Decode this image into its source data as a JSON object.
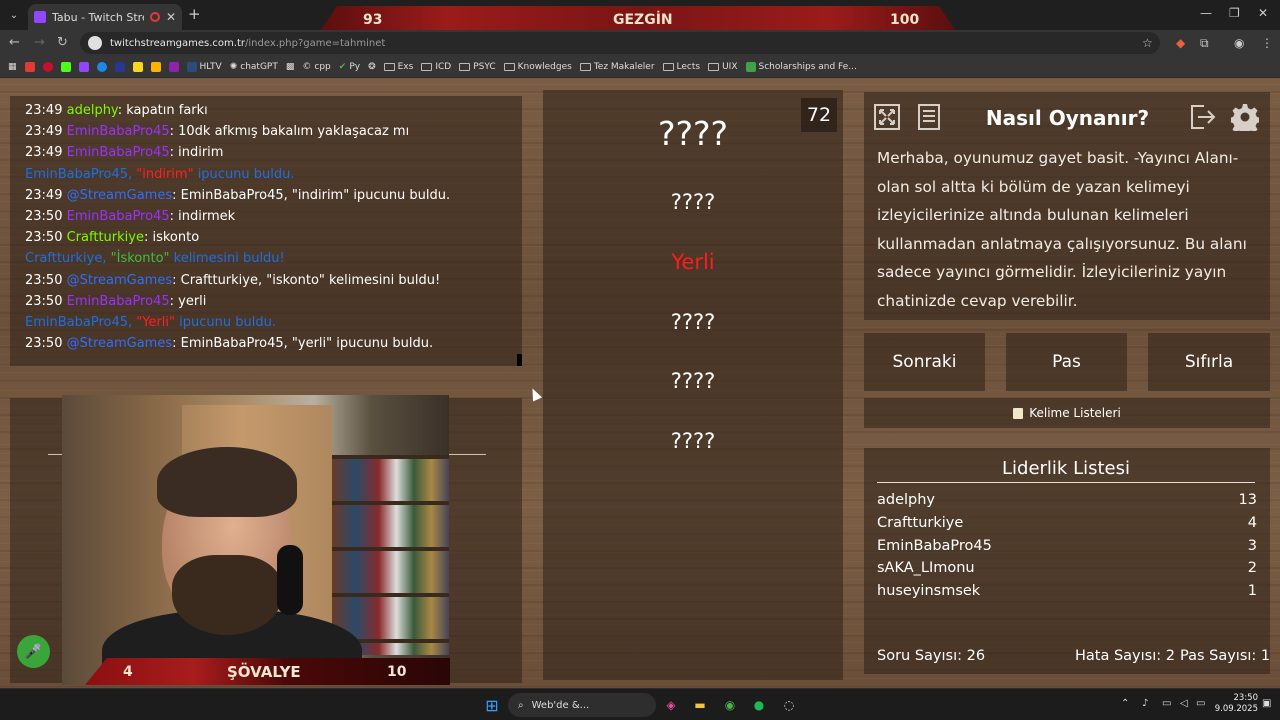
{
  "browser": {
    "tab_title": "Tabu - Twitch Stream Games",
    "url_host": "twitchstreamgames.com.tr",
    "url_path": "/index.php?game=tahminet",
    "bookmarks": [
      "HLTV",
      "chatGPT",
      "cpp",
      "Py",
      "Exs",
      "ICD",
      "PSYC",
      "Knowledges",
      "Tez Makaleler",
      "Lects",
      "UIX",
      "Scholarships and Fe..."
    ]
  },
  "scoreboard": {
    "left": "93",
    "center": "GEZGİN",
    "right": "100"
  },
  "chat": [
    {
      "time": "23:49",
      "user": "adelphy",
      "color": "green",
      "text": ": kapatın farkı"
    },
    {
      "time": "23:49",
      "user": "EminBabaPro45",
      "color": "purple",
      "text": ": 10dk afkmış bakalım yaklaşacaz mı"
    },
    {
      "time": "23:49",
      "user": "EminBabaPro45",
      "color": "purple",
      "text": ": indirim"
    },
    {
      "sys": true,
      "pre": "EminBabaPro45, ",
      "hl": "\"indirim\"",
      "hlcolor": "red",
      "post": " ipucunu buldu."
    },
    {
      "time": "23:49",
      "user": "@StreamGames",
      "color": "blue",
      "text": ": EminBabaPro45, \"indirim\" ipucunu buldu."
    },
    {
      "time": "23:50",
      "user": "EminBabaPro45",
      "color": "purple",
      "text": ": indirmek"
    },
    {
      "time": "23:50",
      "user": "Craftturkiye",
      "color": "green",
      "text": ": iskonto"
    },
    {
      "sys": true,
      "pre": "Craftturkiye, ",
      "hl": "\"İskonto\"",
      "hlcolor": "grn",
      "post": " kelimesini buldu!"
    },
    {
      "time": "23:50",
      "user": "@StreamGames",
      "color": "blue",
      "text": ": Craftturkiye, \"iskonto\" kelimesini buldu!"
    },
    {
      "time": "23:50",
      "user": "EminBabaPro45",
      "color": "purple",
      "text": ": yerli"
    },
    {
      "sys": true,
      "pre": "EminBabaPro45, ",
      "hl": "\"Yerli\"",
      "hlcolor": "red",
      "post": " ipucunu buldu."
    },
    {
      "time": "23:50",
      "user": "@StreamGames",
      "color": "blue",
      "text": ": EminBabaPro45, \"yerli\" ipucunu buldu."
    }
  ],
  "camera_bar": {
    "left": "4",
    "center": "ŞÖVALYE",
    "right": "10"
  },
  "game": {
    "timer": "72",
    "main_word": "????",
    "words": [
      "????",
      "Yerli",
      "????",
      "????",
      "????"
    ]
  },
  "howto": {
    "title": "Nasıl Oynanır?",
    "text": "Merhaba, oyunumuz gayet basit. -Yayıncı Alanı- olan sol altta ki bölüm de yazan kelimeyi izleyicilerinize altında bulunan kelimeleri kullanmadan anlatmaya çalışıyorsunuz. Bu alanı sadece yayıncı görmelidir. İzleyicileriniz yayın chatinizde cevap verebilir."
  },
  "buttons": {
    "next": "Sonraki",
    "pass": "Pas",
    "reset": "Sıfırla",
    "lists": "Kelime Listeleri"
  },
  "leaderboard": {
    "title": "Liderlik Listesi",
    "rows": [
      {
        "name": "adelphy",
        "score": "13"
      },
      {
        "name": "Craftturkiye",
        "score": "4"
      },
      {
        "name": "EminBabaPro45",
        "score": "3"
      },
      {
        "name": "sAKA_LImonu",
        "score": "2"
      },
      {
        "name": "huseyinsmsek",
        "score": "1"
      }
    ]
  },
  "stats": {
    "questions": "Soru Sayısı: 26",
    "errors": "Hata Sayısı: 2",
    "passes": "Pas Sayısı: 1"
  },
  "taskbar": {
    "search": "Web'de &...",
    "time": "23:50",
    "date": "9.09.2025"
  }
}
